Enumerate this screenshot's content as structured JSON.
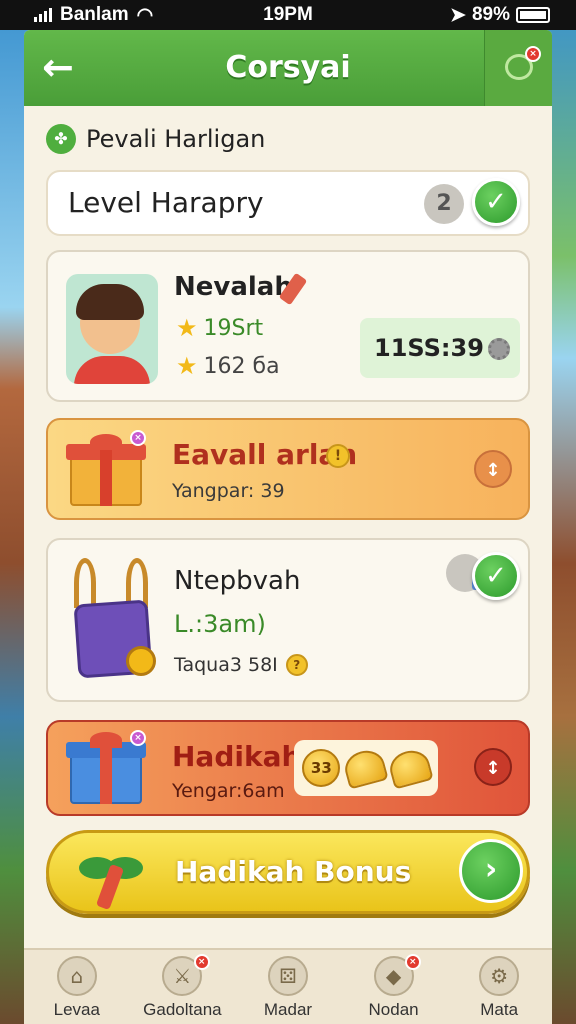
{
  "status_bar": {
    "carrier": "Banlam",
    "time": "19PM",
    "battery": "89%"
  },
  "header": {
    "title": "Corsyai"
  },
  "section": {
    "title": "Pevali Harligan"
  },
  "level_card": {
    "label": "Level Harapry",
    "badge": "2"
  },
  "profile": {
    "name": "Nevalah",
    "stat1": "19Srt",
    "stat2": "162 ба",
    "score": "11SS:39"
  },
  "reward1": {
    "title": "Eavall arlan",
    "subtitle": "Yangpar: 39",
    "info": "!",
    "action": "↕"
  },
  "quest": {
    "title": "Ntepbvah",
    "progress": "L.:3am)",
    "subtitle": "Taqua3 58I"
  },
  "reward2": {
    "title": "Hadikah",
    "subtitle": "Yengar:6am",
    "coin_label": "33",
    "action": "↕"
  },
  "bonus": {
    "label": "Hadikah Bonus"
  },
  "nav": {
    "items": [
      {
        "label": "Levaa",
        "icon": "house-icon",
        "badge": false
      },
      {
        "label": "Gadoltana",
        "icon": "sword-icon",
        "badge": true
      },
      {
        "label": "Madar",
        "icon": "dice-icon",
        "badge": false
      },
      {
        "label": "Nodan",
        "icon": "gem-icon",
        "badge": true
      },
      {
        "label": "Mata",
        "icon": "gear-icon",
        "badge": false
      }
    ]
  },
  "colors": {
    "header_green": "#4a9e38",
    "reward1_orange": "#f7b25c",
    "reward2_red": "#e0543a",
    "bonus_yellow": "#e9c41a"
  }
}
